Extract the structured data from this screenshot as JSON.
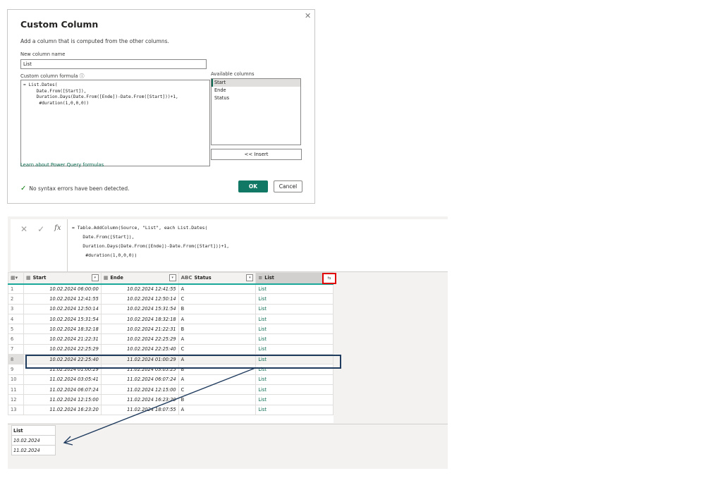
{
  "dialog": {
    "title": "Custom Column",
    "close_glyph": "✕",
    "description": "Add a column that is computed from the other columns.",
    "new_column_label": "New column name",
    "new_column_value": "List",
    "formula_label": "Custom column formula",
    "formula_info_glyph": "ⓘ",
    "formula_lines": [
      "= List.Dates(",
      "     Date.From([Start]),",
      "     Duration.Days(Date.From([Ende])-Date.From([Start]))+1,",
      "      #duration(1,0,0,0))"
    ],
    "available_label": "Available columns",
    "available_columns": [
      "Start",
      "Ende",
      "Status"
    ],
    "insert_label": "<< Insert",
    "learn_link": "Learn about Power Query formulas",
    "syntax_message": "No syntax errors have been detected.",
    "ok_label": "OK",
    "cancel_label": "Cancel"
  },
  "formula_bar": {
    "cancel_glyph": "✕",
    "commit_glyph": "✓",
    "fx_glyph": "fx",
    "lines": [
      "= Table.AddColumn(Source, \"List\", each List.Dates(",
      "    Date.From([Start]),",
      "    Duration.Days(Date.From([Ende])-Date.From([Start]))+1,",
      "     #duration(1,0,0,0))"
    ]
  },
  "grid": {
    "columns": [
      {
        "name": "Start",
        "type_icon": "▦"
      },
      {
        "name": "Ende",
        "type_icon": "▦"
      },
      {
        "name": "Status",
        "type_icon": "ABC"
      },
      {
        "name": "List",
        "type_icon": "≡"
      }
    ],
    "expand_glyph": "⇆",
    "selected_row": 8,
    "rows": [
      [
        "1",
        "10.02.2024 06:00:00",
        "10.02.2024 12:41:55",
        "A",
        "List"
      ],
      [
        "2",
        "10.02.2024 12:41:55",
        "10.02.2024 12:50:14",
        "C",
        "List"
      ],
      [
        "3",
        "10.02.2024 12:50:14",
        "10.02.2024 15:31:54",
        "B",
        "List"
      ],
      [
        "4",
        "10.02.2024 15:31:54",
        "10.02.2024 18:32:18",
        "A",
        "List"
      ],
      [
        "5",
        "10.02.2024 18:32:18",
        "10.02.2024 21:22:31",
        "B",
        "List"
      ],
      [
        "6",
        "10.02.2024 21:22:31",
        "10.02.2024 22:25:29",
        "A",
        "List"
      ],
      [
        "7",
        "10.02.2024 22:25:29",
        "10.02.2024 22:25:40",
        "C",
        "List"
      ],
      [
        "8",
        "10.02.2024 22:25:40",
        "11.02.2024 01:00:29",
        "A",
        "List"
      ],
      [
        "9",
        "11.02.2024 01:00:29",
        "11.02.2024 03:05:25",
        "B",
        "List"
      ],
      [
        "10",
        "11.02.2024 03:05:41",
        "11.02.2024 06:07:24",
        "A",
        "List"
      ],
      [
        "11",
        "11.02.2024 06:07:24",
        "11.02.2024 12:15:00",
        "C",
        "List"
      ],
      [
        "12",
        "11.02.2024 12:15:00",
        "11.02.2024 16:23:20",
        "B",
        "List"
      ],
      [
        "13",
        "11.02.2024 16:23:20",
        "11.02.2024 18:07:55",
        "A",
        "List"
      ]
    ]
  },
  "preview": {
    "header": "List",
    "values": [
      "10.02.2024",
      "11.02.2024"
    ]
  },
  "colors": {
    "accent": "#117865",
    "highlight_box": "#1f3b5e",
    "expand_box": "#e00000"
  }
}
